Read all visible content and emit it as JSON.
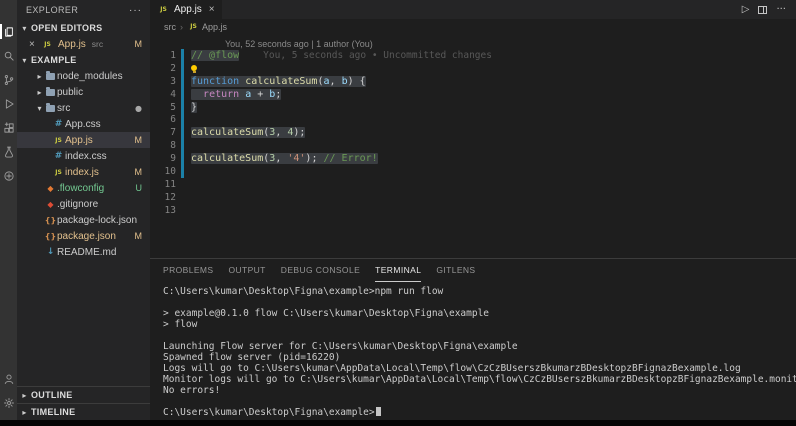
{
  "colors": {
    "editor_bg": "#1e1e1e",
    "sidebar_bg": "#252526",
    "activitybar_bg": "#333333",
    "selection": "#3a3d41",
    "modified_gutter": "#1b81a8",
    "git_modified": "#e2c08d",
    "git_untracked": "#73c991"
  },
  "activity_bar": {
    "icons": [
      {
        "name": "files",
        "active": true
      },
      {
        "name": "search"
      },
      {
        "name": "source-control"
      },
      {
        "name": "debug"
      },
      {
        "name": "extensions"
      },
      {
        "name": "testing"
      },
      {
        "name": "remote"
      },
      {
        "name": "account",
        "bottom": true
      },
      {
        "name": "settings",
        "bottom": true
      }
    ]
  },
  "sidebar": {
    "title": "EXPLORER",
    "more_actions": "···",
    "open_editors": {
      "header": "OPEN EDITORS",
      "file": "App.js",
      "folder": "src",
      "badge": "M"
    },
    "project": {
      "header": "EXAMPLE",
      "items": [
        {
          "label": "node_modules",
          "kind": "folder",
          "state": "collapsed",
          "depth": 0
        },
        {
          "label": "public",
          "kind": "folder",
          "state": "collapsed",
          "depth": 0
        },
        {
          "label": "src",
          "kind": "folder",
          "state": "expanded",
          "depth": 0,
          "dot": true
        },
        {
          "label": "App.css",
          "kind": "file",
          "icon": "css",
          "depth": 1
        },
        {
          "label": "App.js",
          "kind": "file",
          "icon": "js",
          "depth": 1,
          "badge": "M",
          "status": "modified",
          "selected": true
        },
        {
          "label": "index.css",
          "kind": "file",
          "icon": "css",
          "depth": 1
        },
        {
          "label": "index.js",
          "kind": "file",
          "icon": "js",
          "depth": 1,
          "badge": "M",
          "status": "modified"
        },
        {
          "label": ".flowconfig",
          "kind": "file",
          "icon": "flow",
          "depth": 0,
          "badge": "U",
          "status": "untracked"
        },
        {
          "label": ".gitignore",
          "kind": "file",
          "icon": "git",
          "depth": 0
        },
        {
          "label": "package-lock.json",
          "kind": "file",
          "icon": "json",
          "depth": 0
        },
        {
          "label": "package.json",
          "kind": "file",
          "icon": "json",
          "depth": 0,
          "badge": "M",
          "status": "modified"
        },
        {
          "label": "README.md",
          "kind": "file",
          "icon": "md",
          "depth": 0
        }
      ]
    },
    "bottom_sections": [
      {
        "label": "OUTLINE"
      },
      {
        "label": "TIMELINE"
      }
    ]
  },
  "editor": {
    "tab": {
      "label": "App.js",
      "close": "×"
    },
    "breadcrumb": [
      {
        "label": "src"
      },
      {
        "label": "App.js",
        "icon": "js"
      }
    ],
    "actions": [
      {
        "name": "run"
      },
      {
        "name": "split-editor"
      },
      {
        "name": "more-actions"
      }
    ],
    "lines": [
      {
        "type": "codelens",
        "text": "You, 52 seconds ago | 1 author (You)"
      },
      {
        "n": "1",
        "mod": true,
        "sel": true,
        "tokens": [
          {
            "x": "// @flow",
            "c": "comment"
          }
        ],
        "blame": "You, 5 seconds ago • Uncommitted changes"
      },
      {
        "n": "2",
        "mod": true,
        "bulb": true,
        "tokens": []
      },
      {
        "n": "3",
        "mod": true,
        "sel": true,
        "tokens": [
          {
            "x": "function",
            "c": "kw"
          },
          {
            "x": " ",
            "c": "pln"
          },
          {
            "x": "calculateSum",
            "c": "fn"
          },
          {
            "x": "(",
            "c": "pln"
          },
          {
            "x": "a",
            "c": "var"
          },
          {
            "x": ", ",
            "c": "pln"
          },
          {
            "x": "b",
            "c": "var"
          },
          {
            "x": ") {",
            "c": "pln"
          }
        ]
      },
      {
        "n": "4",
        "mod": true,
        "sel": true,
        "tokens": [
          {
            "x": "  ",
            "c": "pln"
          },
          {
            "x": "return",
            "c": "ctrl"
          },
          {
            "x": " ",
            "c": "pln"
          },
          {
            "x": "a",
            "c": "var"
          },
          {
            "x": " + ",
            "c": "pln"
          },
          {
            "x": "b",
            "c": "var"
          },
          {
            "x": ";",
            "c": "pln"
          }
        ]
      },
      {
        "n": "5",
        "mod": true,
        "sel": true,
        "tokens": [
          {
            "x": "}",
            "c": "pln"
          }
        ]
      },
      {
        "n": "6",
        "mod": true,
        "tokens": []
      },
      {
        "n": "7",
        "mod": true,
        "sel": true,
        "tokens": [
          {
            "x": "calculateSum",
            "c": "fn"
          },
          {
            "x": "(",
            "c": "pln"
          },
          {
            "x": "3",
            "c": "num"
          },
          {
            "x": ", ",
            "c": "pln"
          },
          {
            "x": "4",
            "c": "num"
          },
          {
            "x": ");",
            "c": "pln"
          }
        ]
      },
      {
        "n": "8",
        "mod": true,
        "tokens": []
      },
      {
        "n": "9",
        "mod": true,
        "sel": true,
        "tokens": [
          {
            "x": "calculateSum",
            "c": "fn"
          },
          {
            "x": "(",
            "c": "pln"
          },
          {
            "x": "3",
            "c": "num"
          },
          {
            "x": ", ",
            "c": "pln"
          },
          {
            "x": "'4'",
            "c": "str"
          },
          {
            "x": "); ",
            "c": "pln"
          },
          {
            "x": "// Error!",
            "c": "comment"
          }
        ]
      },
      {
        "n": "10",
        "mod": true,
        "tokens": []
      },
      {
        "n": "11",
        "tokens": []
      },
      {
        "n": "12",
        "tokens": []
      },
      {
        "n": "13",
        "tokens": []
      }
    ]
  },
  "panel": {
    "tabs": [
      {
        "label": "PROBLEMS"
      },
      {
        "label": "OUTPUT"
      },
      {
        "label": "DEBUG CONSOLE"
      },
      {
        "label": "TERMINAL",
        "active": true
      },
      {
        "label": "GITLENS"
      }
    ],
    "terminal": {
      "lines": [
        "C:\\Users\\kumar\\Desktop\\Figna\\example>npm run flow",
        "",
        "> example@0.1.0 flow C:\\Users\\kumar\\Desktop\\Figna\\example",
        "> flow",
        "",
        "Launching Flow server for C:\\Users\\kumar\\Desktop\\Figna\\example",
        "Spawned flow server (pid=16220)",
        "Logs will go to C:\\Users\\kumar\\AppData\\Local\\Temp\\flow\\CzCzBUserszBkumarzBDesktopzBFignazBexample.log",
        "Monitor logs will go to C:\\Users\\kumar\\AppData\\Local\\Temp\\flow\\CzCzBUserszBkumarzBDesktopzBFignazBexample.monitor_log",
        "No errors!",
        ""
      ],
      "prompt": "C:\\Users\\kumar\\Desktop\\Figna\\example>"
    }
  }
}
